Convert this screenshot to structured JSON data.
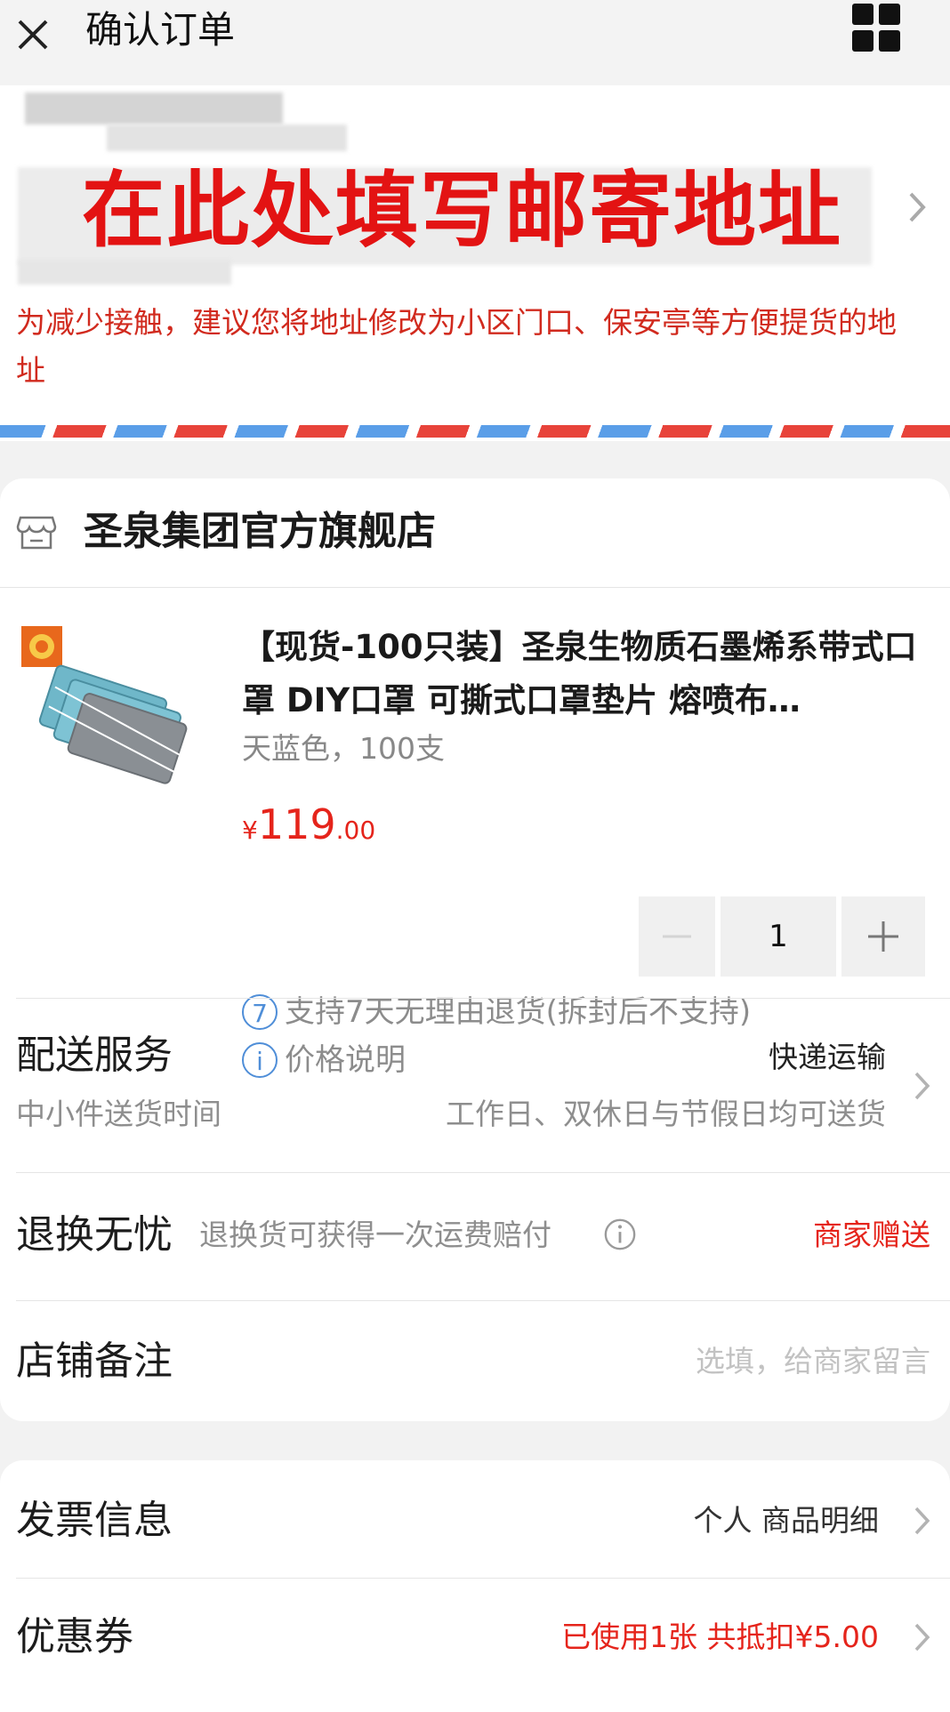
{
  "header": {
    "close_icon": "close-icon",
    "title": "确认订单",
    "menu_icon": "grid-icon"
  },
  "address": {
    "hint": "在此处填写邮寄地址",
    "note": "为减少接触，建议您将地址修改为小区门口、保安亭等方便提货的地址",
    "arrow_icon": "chevron-right-icon"
  },
  "store": {
    "icon": "store-icon",
    "name": "圣泉集团官方旗舰店"
  },
  "product": {
    "title": "【现货-100只装】圣泉生物质石墨烯系带式口罩 DIY口罩 可撕式口罩垫片 熔喷布…",
    "spec": "天蓝色，100支",
    "price_currency": "¥",
    "price_integer": "119",
    "price_decimal": ".00",
    "quantity": "1",
    "services": [
      {
        "icon": "7",
        "text": "支持7天无理由退货(拆封后不支持)"
      },
      {
        "icon": "i",
        "text": "价格说明"
      }
    ]
  },
  "delivery": {
    "label": "配送服务",
    "sub": "中小件送货时间",
    "value": "快递运输",
    "value_sub": "工作日、双休日与节假日均可送货"
  },
  "returns": {
    "label": "退换无忧",
    "sub": "退换货可获得一次运费赔付",
    "value": "商家赠送"
  },
  "remark": {
    "label": "店铺备注",
    "placeholder": "选填，给商家留言"
  },
  "invoice": {
    "label": "发票信息",
    "value": "个人 商品明细"
  },
  "coupon": {
    "label": "优惠券",
    "value": "已使用1张 共抵扣¥5.00"
  },
  "colors": {
    "accent_red": "#e5241b",
    "hint_red": "#e31313",
    "badge_blue": "#4f8ed8"
  }
}
